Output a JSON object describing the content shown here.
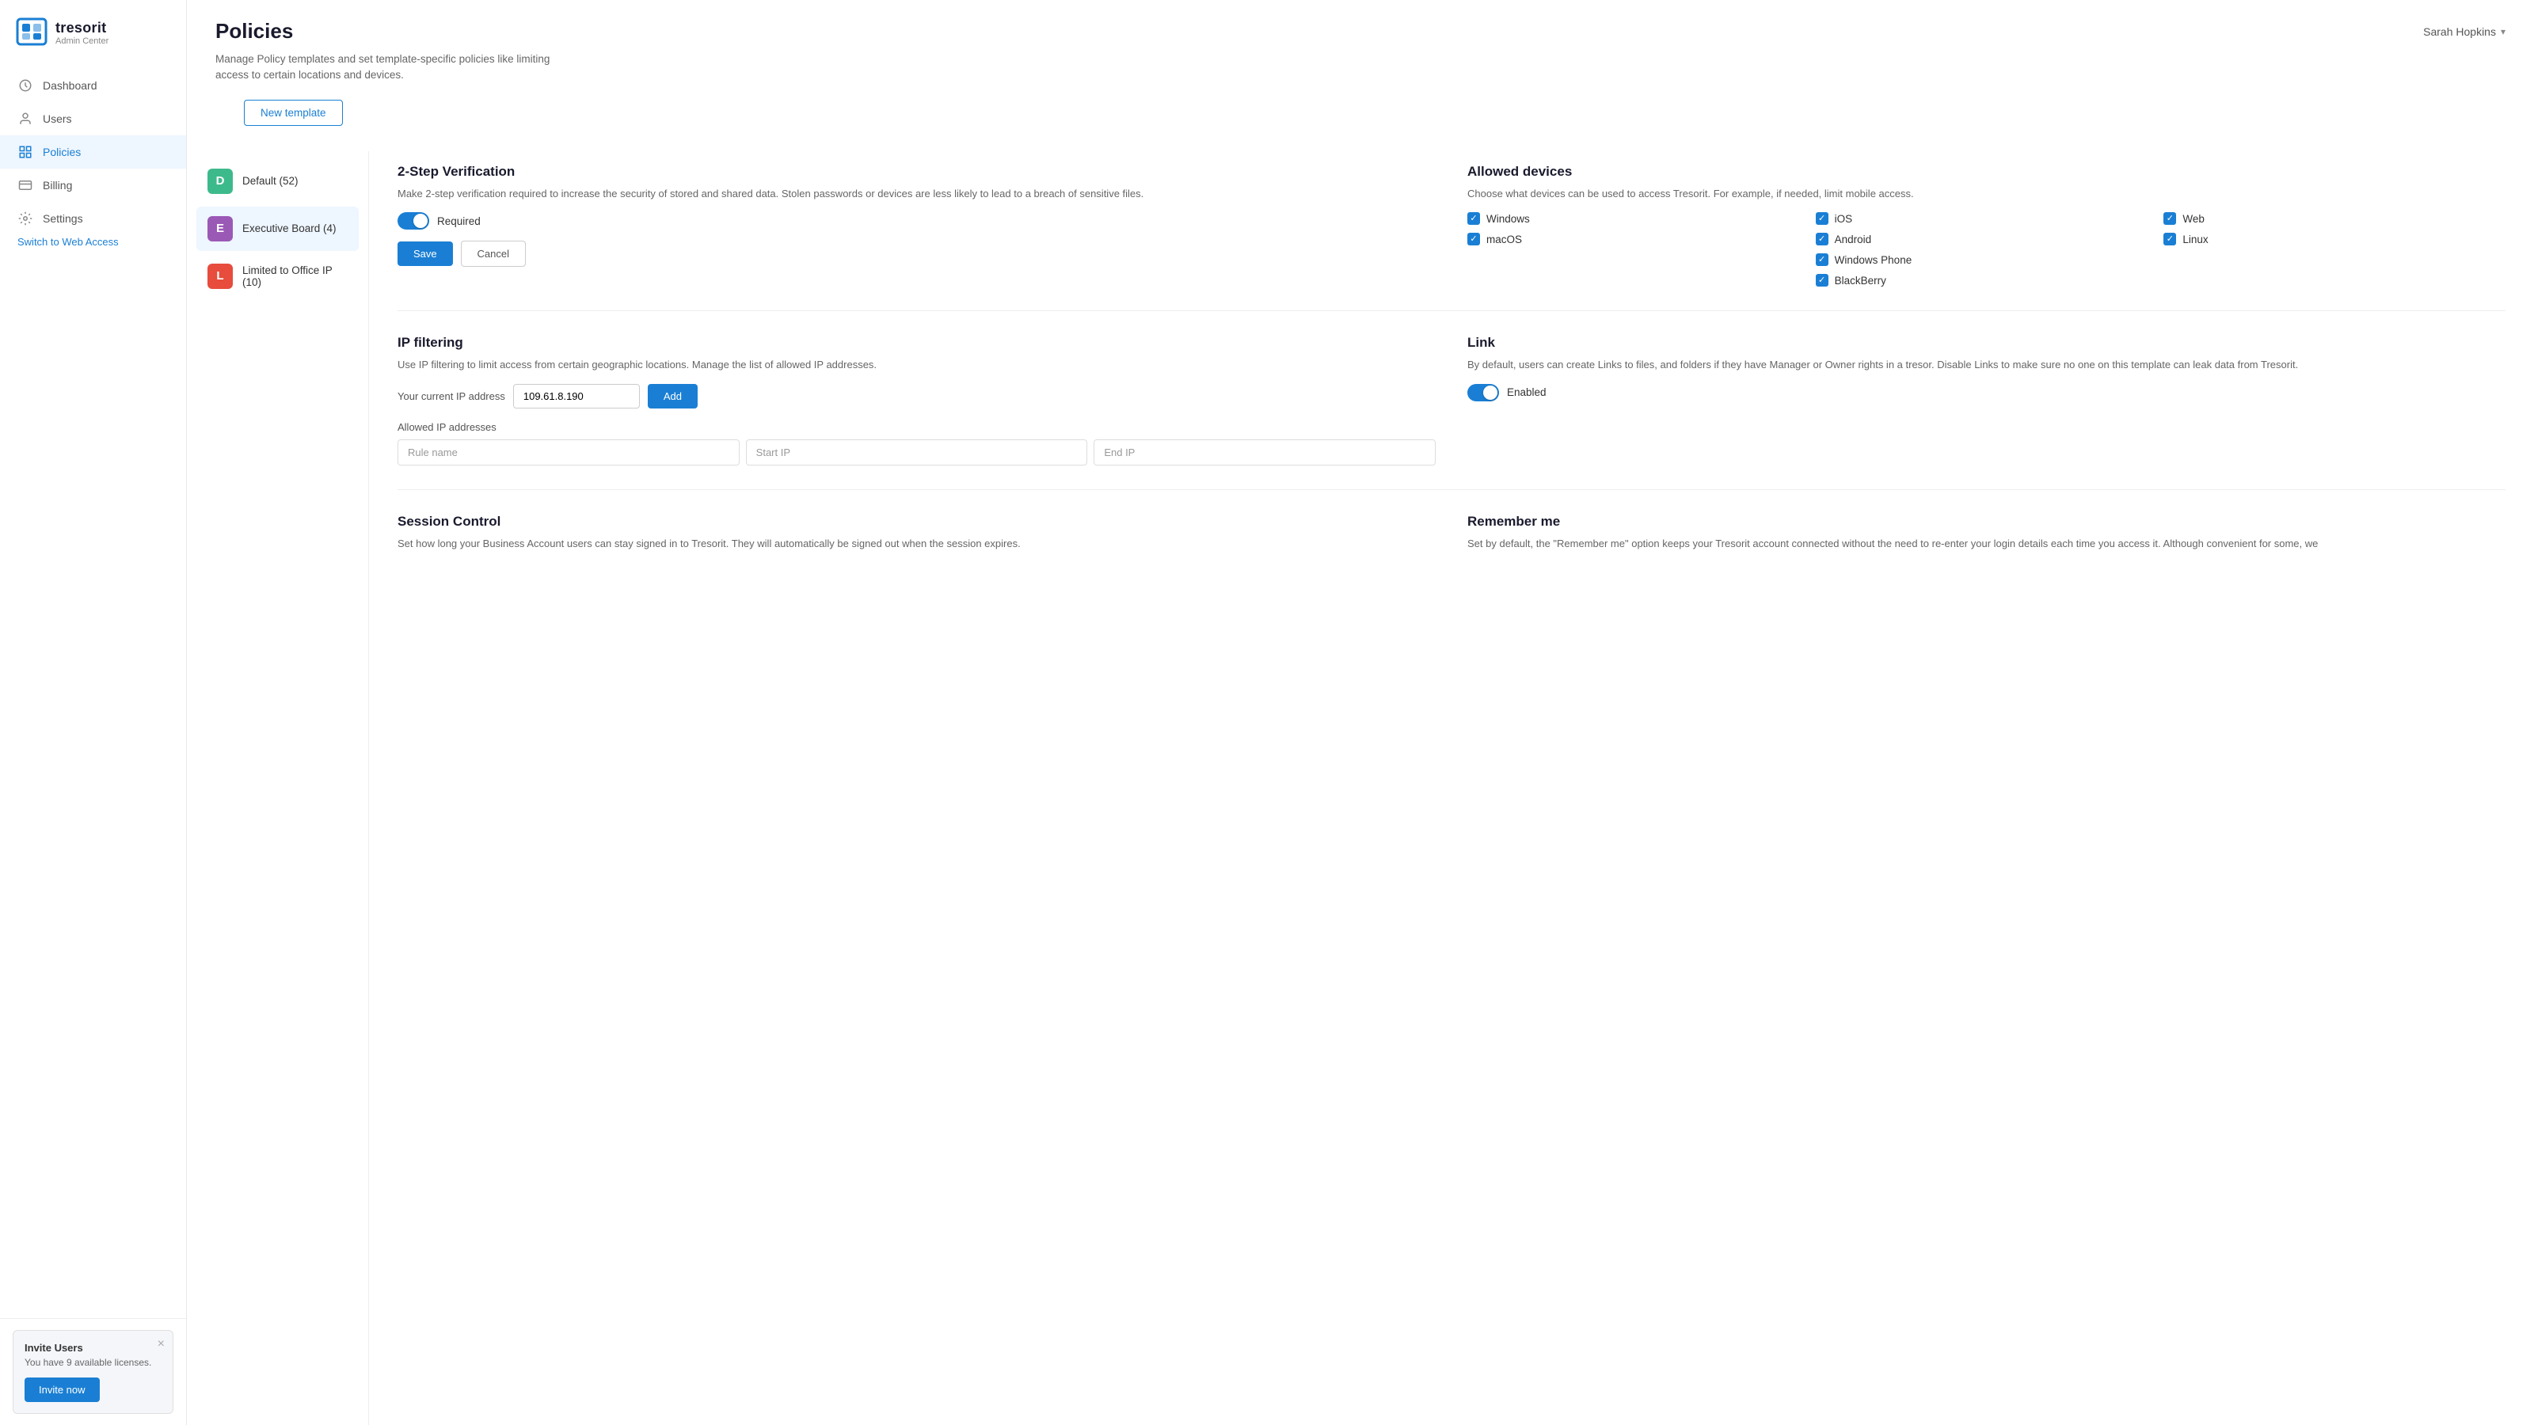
{
  "app": {
    "name": "tresorit",
    "admin_center": "Admin Center"
  },
  "user": {
    "name": "Sarah Hopkins"
  },
  "sidebar": {
    "nav_items": [
      {
        "id": "dashboard",
        "label": "Dashboard",
        "icon": "clock-icon",
        "active": false
      },
      {
        "id": "users",
        "label": "Users",
        "icon": "user-icon",
        "active": false
      },
      {
        "id": "policies",
        "label": "Policies",
        "icon": "grid-icon",
        "active": true
      },
      {
        "id": "billing",
        "label": "Billing",
        "icon": "card-icon",
        "active": false
      },
      {
        "id": "settings",
        "label": "Settings",
        "icon": "settings-icon",
        "active": false
      }
    ],
    "switch_web": "Switch to Web Access",
    "invite": {
      "title": "Invite Users",
      "desc": "You have 9 available licenses.",
      "btn": "Invite now"
    }
  },
  "page": {
    "title": "Policies",
    "subtitle_line1": "Manage Policy templates and set template-specific policies like limiting",
    "subtitle_line2": "access to certain locations and devices.",
    "new_template_btn": "New template"
  },
  "templates": [
    {
      "id": "default",
      "label": "Default (52)",
      "initial": "D",
      "color": "default"
    },
    {
      "id": "exec",
      "label": "Executive Board (4)",
      "initial": "E",
      "color": "exec"
    },
    {
      "id": "limited",
      "label": "Limited to Office IP (10)",
      "initial": "L",
      "color": "limited"
    }
  ],
  "panels": {
    "two_step": {
      "title": "2-Step Verification",
      "desc": "Make 2-step verification required to increase the security of stored and shared data. Stolen passwords or devices are less likely to lead to a breach of sensitive files.",
      "toggle_label": "Required",
      "toggle_on": true,
      "save_btn": "Save",
      "cancel_btn": "Cancel"
    },
    "allowed_devices": {
      "title": "Allowed devices",
      "desc": "Choose what devices can be used to access Tresorit. For example, if needed, limit mobile access.",
      "devices": [
        {
          "label": "Windows",
          "checked": true
        },
        {
          "label": "iOS",
          "checked": true
        },
        {
          "label": "Web",
          "checked": true
        },
        {
          "label": "macOS",
          "checked": true
        },
        {
          "label": "Android",
          "checked": true
        },
        {
          "label": "Linux",
          "checked": true
        },
        {
          "label": "Windows Phone",
          "checked": true
        },
        {
          "label": "BlackBerry",
          "checked": true
        }
      ]
    },
    "ip_filtering": {
      "title": "IP filtering",
      "desc": "Use IP filtering to limit access from certain geographic locations. Manage the list of allowed IP addresses.",
      "current_ip_label": "Your current IP address",
      "current_ip_value": "109.61.8.190",
      "add_btn": "Add",
      "allowed_label": "Allowed IP addresses",
      "table_headers": [
        "Rule name",
        "Start IP",
        "End IP"
      ]
    },
    "link": {
      "title": "Link",
      "desc": "By default, users can create Links to files, and folders if they have Manager or Owner rights in a tresor. Disable Links to make sure no one on this template can leak data from Tresorit.",
      "toggle_label": "Enabled",
      "toggle_on": true
    },
    "session_control": {
      "title": "Session Control",
      "desc": "Set how long your Business Account users can stay signed in to Tresorit. They will automatically be signed out when the session expires."
    },
    "remember_me": {
      "title": "Remember me",
      "desc": "Set by default, the \"Remember me\" option keeps your Tresorit account connected without the need to re-enter your login details each time you access it. Although convenient for some, we"
    }
  },
  "colors": {
    "primary": "#1a7fd4",
    "badge_default": "#3dba8c",
    "badge_exec": "#9b59b6",
    "badge_limited": "#e74c3c"
  }
}
